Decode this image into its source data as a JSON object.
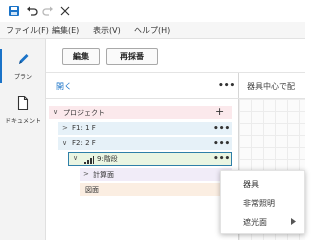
{
  "titlebar": {
    "icons": [
      "save-icon",
      "undo-icon",
      "redo-icon",
      "close-icon"
    ]
  },
  "menubar": {
    "items": [
      {
        "label": "ファイル(F)"
      },
      {
        "label": "編集(E)"
      },
      {
        "label": "表示(V)"
      },
      {
        "label": "ヘルプ(H)"
      }
    ]
  },
  "sidebar": {
    "items": [
      {
        "label": "プラン",
        "icon": "pencil-icon",
        "active": true
      },
      {
        "label": "ドキュメント",
        "icon": "document-icon",
        "active": false
      }
    ]
  },
  "toolbar": {
    "edit_label": "編集",
    "renumber_label": "再採番"
  },
  "panel": {
    "title": "開く",
    "tree": {
      "project_label": "プロジェクト",
      "floor1_label": "F1: 1 F",
      "floor2_label": "F2: 2 F",
      "stair_label": "9:階段",
      "calc_label": "計算面",
      "drawing_label": "図面"
    }
  },
  "right_pane": {
    "title": "器具中心で配"
  },
  "context_menu": {
    "items": [
      {
        "label": "器具"
      },
      {
        "label": "非常照明"
      },
      {
        "label": "遮光面"
      }
    ]
  },
  "colors": {
    "accent": "#1a73c8",
    "project_row_bg": "#fbe9ec",
    "floor_row_bg": "#e6f1f8",
    "stair_row_bg": "#eaf5e2",
    "stair_border": "#2f7fa8",
    "calc_row_bg": "#f1ecf8",
    "drawing_row_bg": "#fbeee2"
  }
}
